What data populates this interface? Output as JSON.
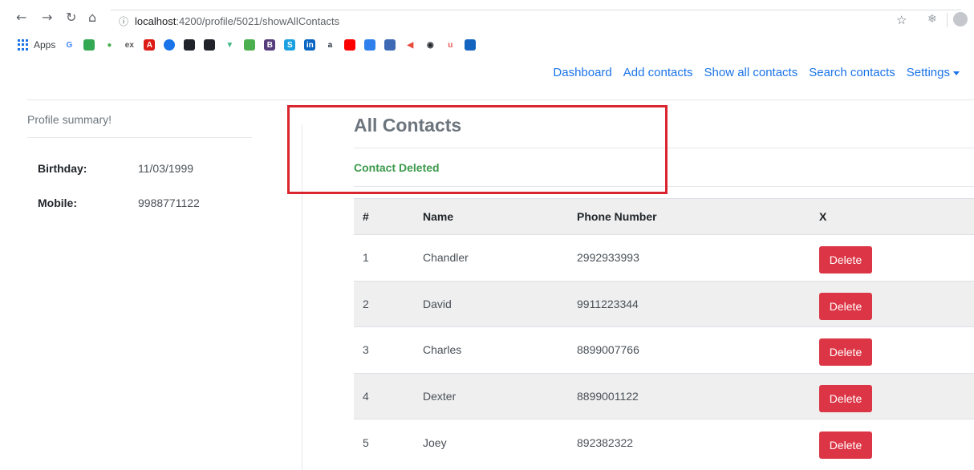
{
  "browser": {
    "url_host": "localhost",
    "url_path": ":4200/profile/5021/showAllContacts",
    "bookmarks_label": "Apps"
  },
  "nav": {
    "items": [
      {
        "label": "Dashboard"
      },
      {
        "label": "Add contacts"
      },
      {
        "label": "Show all contacts"
      },
      {
        "label": "Search contacts"
      },
      {
        "label": "Settings"
      }
    ]
  },
  "profile": {
    "title": "Profile summary!",
    "birthday_label": "Birthday:",
    "birthday_value": "11/03/1999",
    "mobile_label": "Mobile:",
    "mobile_value": "9988771122"
  },
  "main": {
    "title": "All Contacts",
    "status": "Contact Deleted",
    "status_color": "#3c9a4c",
    "highlight_color": "#d9262e"
  },
  "table": {
    "headers": [
      "#",
      "Name",
      "Phone Number",
      "X"
    ],
    "rows": [
      {
        "num": "1",
        "name": "Chandler",
        "phone": "2992933993",
        "action": "Delete"
      },
      {
        "num": "2",
        "name": "David",
        "phone": "9911223344",
        "action": "Delete"
      },
      {
        "num": "3",
        "name": "Charles",
        "phone": "8899007766",
        "action": "Delete"
      },
      {
        "num": "4",
        "name": "Dexter",
        "phone": "8899001122",
        "action": "Delete"
      },
      {
        "num": "5",
        "name": "Joey",
        "phone": "892382322",
        "action": "Delete"
      }
    ]
  }
}
